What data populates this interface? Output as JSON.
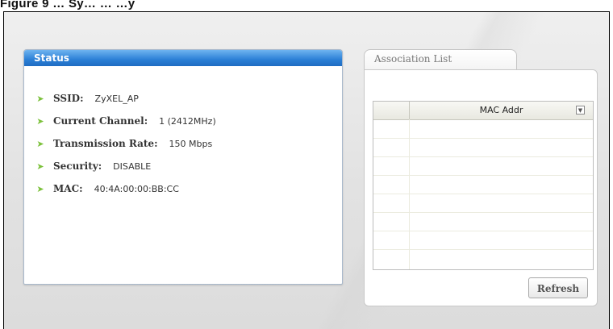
{
  "caption": "Figure 9 … Sy… … …y",
  "status": {
    "title": "Status",
    "items": [
      {
        "label": "SSID:",
        "value": "ZyXEL_AP"
      },
      {
        "label": "Current Channel:",
        "value": "1 (2412MHz)"
      },
      {
        "label": "Transmission Rate:",
        "value": "150 Mbps"
      },
      {
        "label": "Security:",
        "value": "DISABLE"
      },
      {
        "label": "MAC:",
        "value": "40:4A:00:00:BB:CC"
      }
    ]
  },
  "association": {
    "tab_label": "Association List",
    "column_header": "MAC Addr",
    "refresh_label": "Refresh"
  },
  "icons": {
    "bullet": "chevron-right-icon",
    "sort": "chevron-down-icon"
  },
  "colors": {
    "status_header": "#2b7fd6",
    "bullet": "#7cc13b"
  }
}
